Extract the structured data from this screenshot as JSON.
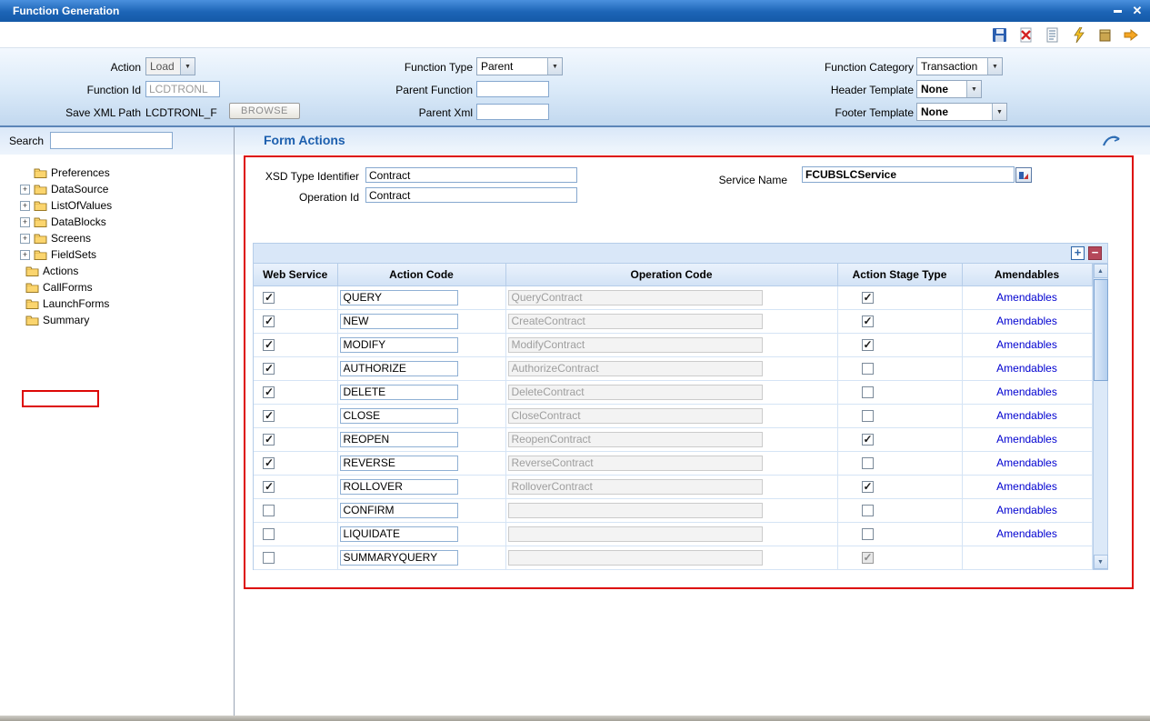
{
  "window": {
    "title": "Function Generation"
  },
  "toolbar": {
    "icons": [
      "save-icon",
      "delete-xml-icon",
      "view-source-icon",
      "generate-icon",
      "build-icon",
      "forward-icon"
    ]
  },
  "header": {
    "action": {
      "label": "Action",
      "value": "Load"
    },
    "function_id": {
      "label": "Function Id",
      "value": "LCDTRONL"
    },
    "save_xml_path": {
      "label": "Save XML Path",
      "value": "LCDTRONL_F"
    },
    "browse": "BROWSE",
    "function_type": {
      "label": "Function Type",
      "value": "Parent"
    },
    "parent_function": {
      "label": "Parent Function",
      "value": ""
    },
    "parent_xml": {
      "label": "Parent Xml",
      "value": ""
    },
    "function_category": {
      "label": "Function Category",
      "value": "Transaction"
    },
    "header_template": {
      "label": "Header Template",
      "value": "None"
    },
    "footer_template": {
      "label": "Footer Template",
      "value": "None"
    }
  },
  "sidebar": {
    "search_label": "Search",
    "search_value": "",
    "tree": [
      {
        "label": "Preferences",
        "indent": "slot"
      },
      {
        "label": "DataSource",
        "indent": "expander"
      },
      {
        "label": "ListOfValues",
        "indent": "expander"
      },
      {
        "label": "DataBlocks",
        "indent": "expander"
      },
      {
        "label": "Screens",
        "indent": "expander"
      },
      {
        "label": "FieldSets",
        "indent": "expander"
      },
      {
        "label": "Actions",
        "indent": "none",
        "highlighted": true
      },
      {
        "label": "CallForms",
        "indent": "none"
      },
      {
        "label": "LaunchForms",
        "indent": "none"
      },
      {
        "label": "Summary",
        "indent": "none"
      }
    ]
  },
  "main": {
    "title": "Form Actions",
    "form": {
      "xsd_type_identifier": {
        "label": "XSD Type Identifier",
        "value": "Contract"
      },
      "operation_id": {
        "label": "Operation Id",
        "value": "Contract"
      },
      "service_name": {
        "label": "Service Name",
        "value": "FCUBSLCService"
      }
    },
    "table": {
      "headers": [
        "Web Service",
        "Action Code",
        "Operation Code",
        "Action Stage Type",
        "Amendables"
      ],
      "amendables_label": "Amendables",
      "rows": [
        {
          "web_service": true,
          "action_code": "QUERY",
          "operation_code": "QueryContract",
          "action_stage_type": true,
          "action_stage_disabled": false,
          "amendables": true
        },
        {
          "web_service": true,
          "action_code": "NEW",
          "operation_code": "CreateContract",
          "action_stage_type": true,
          "action_stage_disabled": false,
          "amendables": true
        },
        {
          "web_service": true,
          "action_code": "MODIFY",
          "operation_code": "ModifyContract",
          "action_stage_type": true,
          "action_stage_disabled": false,
          "amendables": true
        },
        {
          "web_service": true,
          "action_code": "AUTHORIZE",
          "operation_code": "AuthorizeContract",
          "action_stage_type": false,
          "action_stage_disabled": false,
          "amendables": true
        },
        {
          "web_service": true,
          "action_code": "DELETE",
          "operation_code": "DeleteContract",
          "action_stage_type": false,
          "action_stage_disabled": false,
          "amendables": true
        },
        {
          "web_service": true,
          "action_code": "CLOSE",
          "operation_code": "CloseContract",
          "action_stage_type": false,
          "action_stage_disabled": false,
          "amendables": true
        },
        {
          "web_service": true,
          "action_code": "REOPEN",
          "operation_code": "ReopenContract",
          "action_stage_type": true,
          "action_stage_disabled": false,
          "amendables": true
        },
        {
          "web_service": true,
          "action_code": "REVERSE",
          "operation_code": "ReverseContract",
          "action_stage_type": false,
          "action_stage_disabled": false,
          "amendables": true
        },
        {
          "web_service": true,
          "action_code": "ROLLOVER",
          "operation_code": "RolloverContract",
          "action_stage_type": true,
          "action_stage_disabled": false,
          "amendables": true
        },
        {
          "web_service": false,
          "action_code": "CONFIRM",
          "operation_code": "",
          "action_stage_type": false,
          "action_stage_disabled": false,
          "amendables": true
        },
        {
          "web_service": false,
          "action_code": "LIQUIDATE",
          "operation_code": "",
          "action_stage_type": false,
          "action_stage_disabled": false,
          "amendables": true
        },
        {
          "web_service": false,
          "action_code": "SUMMARYQUERY",
          "operation_code": "",
          "action_stage_type": true,
          "action_stage_disabled": true,
          "amendables": false
        }
      ]
    }
  }
}
